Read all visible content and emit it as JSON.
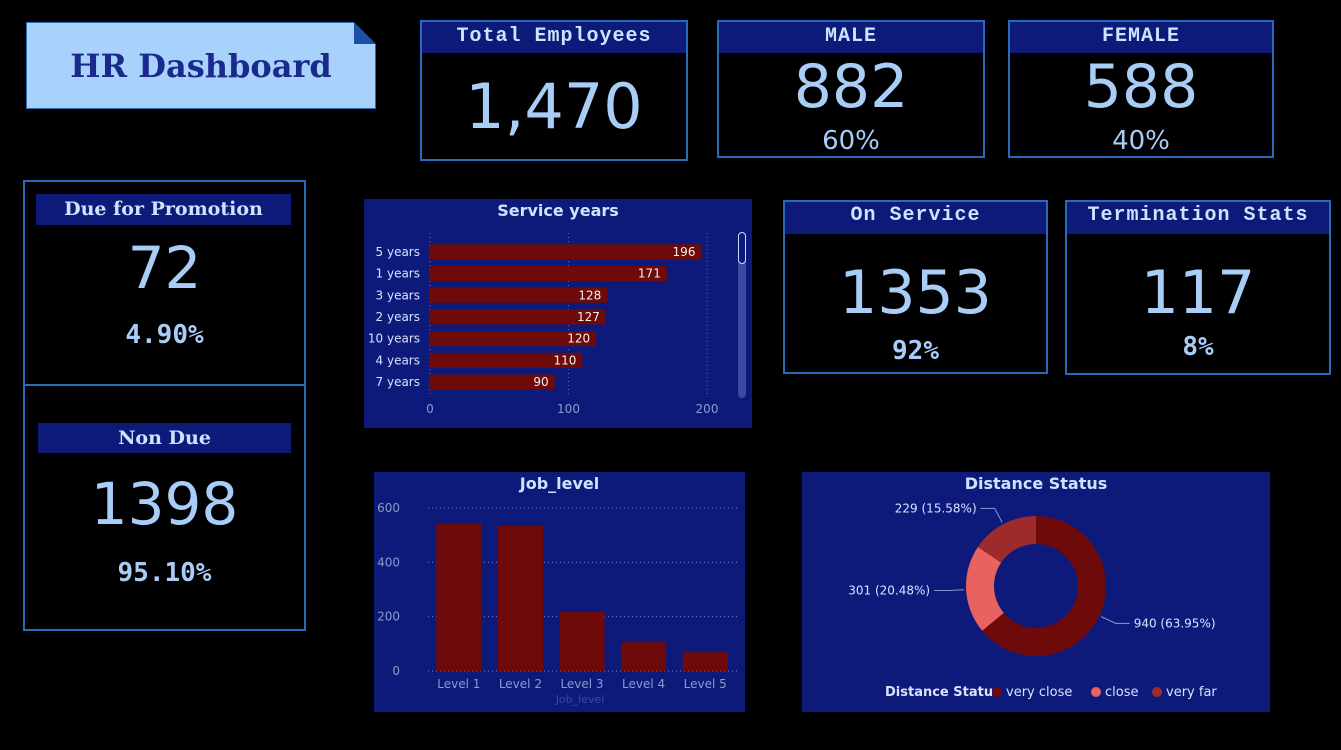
{
  "header": {
    "title": "HR Dashboard"
  },
  "total_employees": {
    "label": "Total Employees",
    "value": "1,470"
  },
  "male": {
    "label": "MALE",
    "value": "882",
    "pct": "60%"
  },
  "female": {
    "label": "FEMALE",
    "value": "588",
    "pct": "40%"
  },
  "due_promotion": {
    "label": "Due for Promotion",
    "value": "72",
    "pct": "4.90%"
  },
  "non_due": {
    "label": "Non Due",
    "value": "1398",
    "pct": "95.10%"
  },
  "on_service": {
    "label": "On Service",
    "value": "1353",
    "pct": "92%"
  },
  "termination": {
    "label": "Termination Stats",
    "value": "117",
    "pct": "8%"
  },
  "colors": {
    "bar": "#6e0a0a",
    "panel": "#0d1a7a",
    "kpi_border": "#2a6bb8",
    "text": "#a8cdf7"
  },
  "chart_data": [
    {
      "id": "service_years",
      "type": "bar",
      "orientation": "horizontal",
      "title": "Service years",
      "categories": [
        "5 years",
        "1 years",
        "3 years",
        "2 years",
        "10 years",
        "4 years",
        "7 years"
      ],
      "values": [
        196,
        171,
        128,
        127,
        120,
        110,
        90
      ],
      "xlim": [
        0,
        200
      ],
      "xticks": [
        0,
        100,
        200
      ]
    },
    {
      "id": "job_level",
      "type": "bar",
      "title": "Job_level",
      "xlabel": "Job_level",
      "categories": [
        "Level 1",
        "Level 2",
        "Level 3",
        "Level 4",
        "Level 5"
      ],
      "values": [
        543,
        534,
        218,
        106,
        69
      ],
      "ylim": [
        0,
        600
      ],
      "yticks": [
        0,
        200,
        400,
        600
      ]
    },
    {
      "id": "distance_status",
      "type": "pie",
      "donut": true,
      "title": "Distance Status",
      "legend_title": "Distance Status",
      "labels": [
        "very close",
        "close",
        "very far"
      ],
      "values": [
        940,
        301,
        229
      ],
      "data_labels": [
        "940 (63.95%)",
        "301 (20.48%)",
        "229 (15.58%)"
      ],
      "colors": [
        "#6e0a0a",
        "#e8625f",
        "#9e2b2b"
      ],
      "legend_position": "bottom"
    }
  ]
}
